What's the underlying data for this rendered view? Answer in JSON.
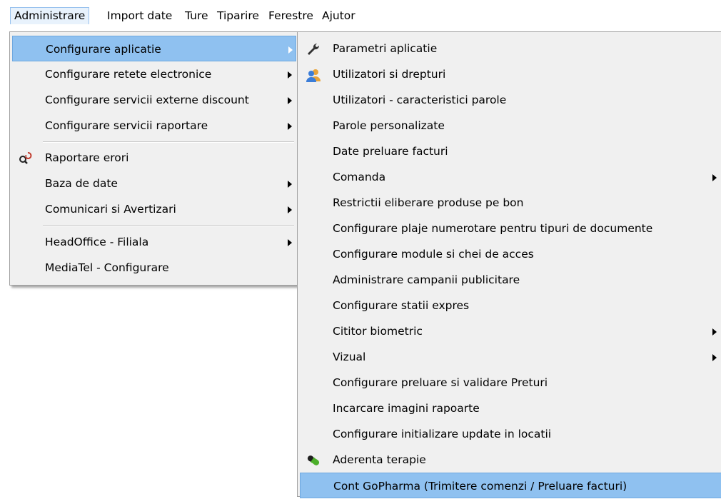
{
  "menubar": {
    "items": [
      "Administrare",
      "Import date",
      "Ture",
      "Tiparire",
      "Ferestre",
      "Ajutor"
    ]
  },
  "admin_menu": {
    "items": [
      "Configurare aplicatie",
      "Configurare retete electronice",
      "Configurare servicii externe discount",
      "Configurare servicii raportare",
      "Raportare erori",
      "Baza de date",
      "Comunicari si Avertizari",
      "HeadOffice - Filiala",
      "MediaTel - Configurare"
    ]
  },
  "submenu": {
    "items": [
      "Parametri aplicatie",
      "Utilizatori si drepturi",
      "Utilizatori - caracteristici parole",
      "Parole personalizate",
      "Date preluare facturi",
      "Comanda",
      "Restrictii eliberare produse pe bon",
      "Configurare plaje numerotare pentru tipuri de documente",
      "Configurare module si chei de acces",
      "Administrare campanii publicitare",
      "Configurare statii expres",
      "Cititor biometric",
      "Vizual",
      "Configurare preluare si validare Preturi",
      "Incarcare imagini rapoarte",
      "Configurare initializare update in locatii",
      "Aderenta terapie",
      "Cont GoPharma (Trimitere comenzi / Preluare facturi)"
    ]
  },
  "icons": {
    "parametri": "wrench-icon",
    "utilizatori": "users-icon",
    "raportare": "magnifier-refresh-icon",
    "aderenta": "pill-icon"
  },
  "colors": {
    "highlight": "#8fc1f0",
    "menu_bg": "#f0f0f0",
    "menubar_active": "#e8f2fc"
  }
}
